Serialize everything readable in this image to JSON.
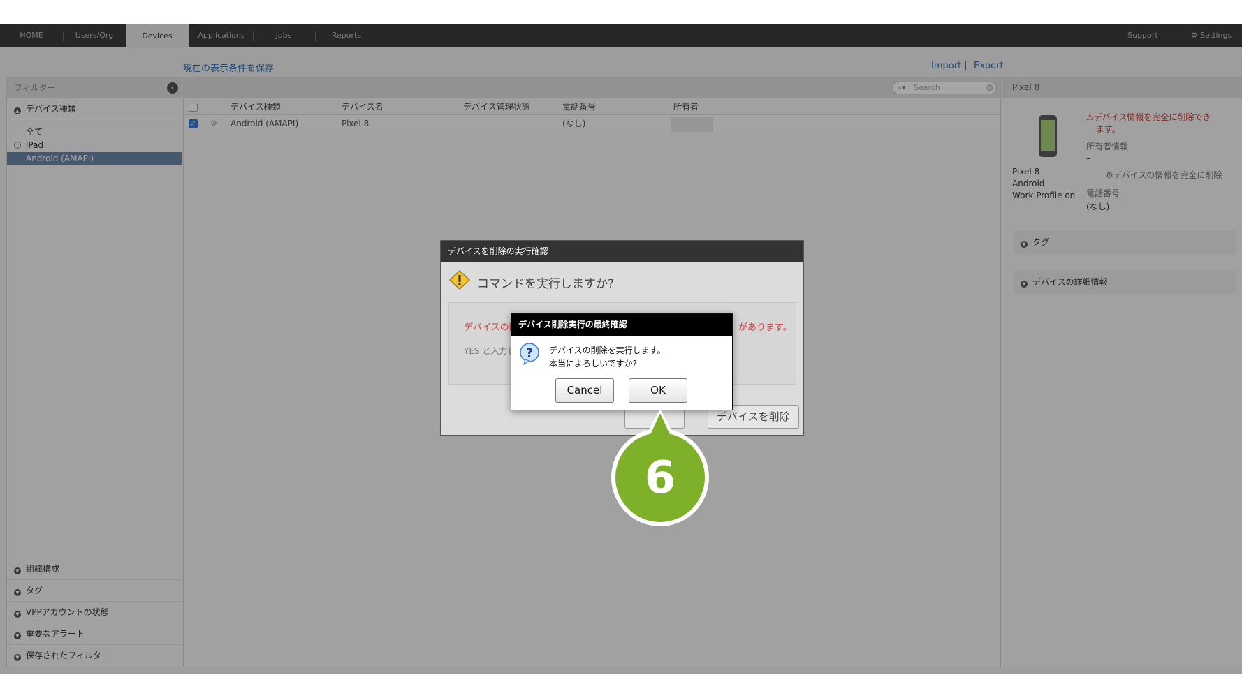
{
  "topnav": {
    "tabs": [
      "HOME",
      "Users/Org",
      "Devices",
      "Applications",
      "Jobs",
      "Reports"
    ],
    "active_tab": "Devices",
    "support": "Support",
    "settings": "Settings"
  },
  "toolbar": {
    "save_view": "現在の表示条件を保存",
    "import": "Import",
    "export": "Export",
    "separator": "|"
  },
  "filter": {
    "header": "フィルター",
    "device_type_section": "デバイス種類",
    "items": [
      "全て",
      "iPad",
      "Android (AMAPI)"
    ],
    "selected_item": "Android (AMAPI)",
    "bottom_sections": [
      "組織構成",
      "タグ",
      "VPPアカウントの状態",
      "重要なアラート",
      "保存されたフィルター"
    ]
  },
  "search": {
    "placeholder": "Search"
  },
  "table": {
    "columns": [
      "デバイス種類",
      "デバイス名",
      "デバイス管理状態",
      "電話番号",
      "所有者"
    ],
    "rows": [
      {
        "checked": true,
        "device_type": "Android (AMAPI)",
        "device_name": "Pixel 8",
        "status": "–",
        "phone": "(なし)",
        "owner": ""
      }
    ]
  },
  "detail": {
    "header": "Pixel 8",
    "name": "Pixel 8",
    "os": "Android",
    "profile": "Work Profile on",
    "warning_line1": "デバイス情報を完全に削除でき",
    "warning_line2": "ます。",
    "owner_label": "所有者情報",
    "owner_value": "–",
    "delete_link": "デバイスの情報を完全に削除",
    "phone_label": "電話番号",
    "phone_value": "(なし)",
    "sections": [
      "タグ",
      "デバイスの詳細情報"
    ]
  },
  "dialog_confirm": {
    "title": "デバイスを削除の実行確認",
    "question": "コマンドを実行しますか?",
    "red_left": "デバイスの削",
    "red_right": "があります。",
    "hint": "YES と入力し",
    "cancel_partial": "",
    "delete_button": "デバイスを削除"
  },
  "dialog_final": {
    "title": "デバイス削除実行の最終確認",
    "message_line1": "デバイスの削除を実行します。",
    "message_line2": "本当によろしいですか?",
    "cancel": "Cancel",
    "ok": "OK"
  },
  "callout": {
    "step": "6",
    "color": "#7fb02a"
  }
}
